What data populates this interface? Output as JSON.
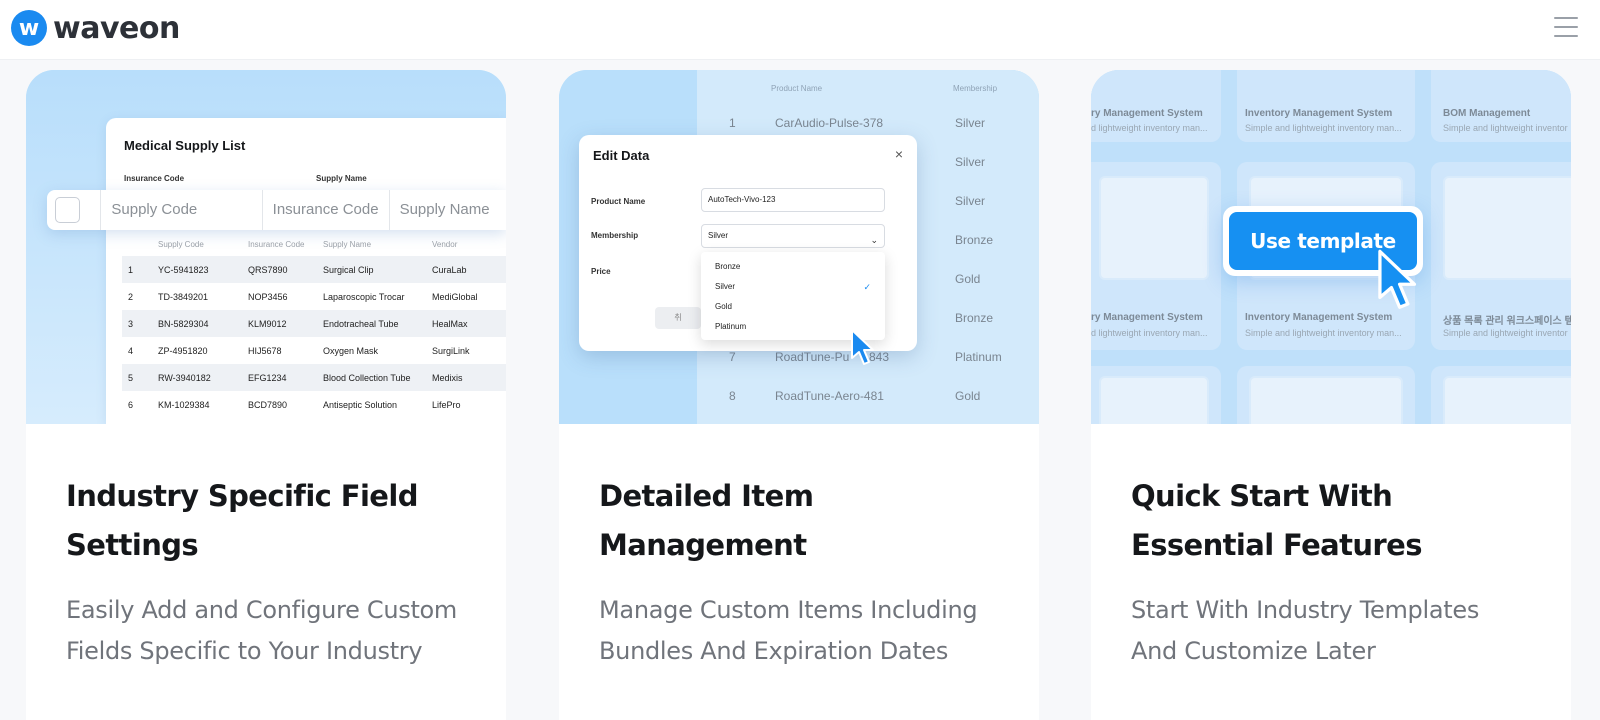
{
  "brand": {
    "name": "waveon",
    "mark": "w"
  },
  "colors": {
    "accent": "#1a8af0",
    "title": "#15171a",
    "description": "#70747b"
  },
  "header": {
    "menu_icon": "hamburger-menu-icon"
  },
  "cards": [
    {
      "title": "Industry Specific Field Settings",
      "description": "Easily Add and Configure Custom Fields Specific to Your Industry",
      "mock": {
        "panel_title": "Medical Supply List",
        "field_labels": [
          "Insurance Code",
          "Supply Name"
        ],
        "filter_columns": [
          "Supply Code",
          "Insurance Code",
          "Supply Name"
        ],
        "table_headers": [
          "Supply Code",
          "Insurance Code",
          "Supply Name",
          "Vendor"
        ],
        "rows": [
          [
            "1",
            "YC-5941823",
            "QRS7890",
            "Surgical Clip",
            "CuraLab"
          ],
          [
            "2",
            "TD-3849201",
            "NOP3456",
            "Laparoscopic Trocar",
            "MediGlobal"
          ],
          [
            "3",
            "BN-5829304",
            "KLM9012",
            "Endotracheal Tube",
            "HealMax"
          ],
          [
            "4",
            "ZP-4951820",
            "HIJ5678",
            "Oxygen Mask",
            "SurgiLink"
          ],
          [
            "5",
            "RW-3940182",
            "EFG1234",
            "Blood Collection Tube",
            "Medixis"
          ],
          [
            "6",
            "KM-1029384",
            "BCD7890",
            "Antiseptic Solution",
            "LifePro"
          ]
        ]
      }
    },
    {
      "title": "Detailed Item Management",
      "description": "Manage Custom Items Including Bundles And Expiration Dates",
      "mock": {
        "list_headers": [
          "Product Name",
          "Membership"
        ],
        "list_rows": [
          [
            "1",
            "CarAudio-Pulse-378",
            "Silver"
          ],
          [
            "2",
            "",
            "Silver"
          ],
          [
            "3",
            "",
            "Silver"
          ],
          [
            "4",
            "",
            "Bronze"
          ],
          [
            "5",
            "",
            "Gold"
          ],
          [
            "6",
            "",
            "Bronze"
          ],
          [
            "7",
            "RoadTune-Pu",
            "843",
            "Platinum"
          ],
          [
            "8",
            "RoadTune-Aero-481",
            "Gold"
          ]
        ],
        "modal_title": "Edit Data",
        "close_icon": "×",
        "product_name_label": "Product Name",
        "product_name_value": "AutoTech-Vivo-123",
        "membership_label": "Membership",
        "membership_value": "Silver",
        "price_label": "Price",
        "options": [
          "Bronze",
          "Silver",
          "Gold",
          "Platinum"
        ],
        "selected_option": "Silver",
        "check_mark": "✓",
        "cancel_fragment": "취"
      }
    },
    {
      "title": "Quick Start With Essential Features",
      "description": "Start With Industry Templates And Customize Later",
      "mock": {
        "use_template_label": "Use template",
        "tiles_row1": [
          {
            "title": "ry Management System",
            "subtitle": "d lightweight inventory man..."
          },
          {
            "title": "Inventory Management System",
            "subtitle": "Simple and lightweight inventory man..."
          },
          {
            "title": "BOM Management",
            "subtitle": "Simple and lightweight inventor"
          }
        ],
        "tiles_row2": [
          {
            "title": "ry Management System",
            "subtitle": "d lightweight inventory man..."
          },
          {
            "title": "Inventory Management System",
            "subtitle": "Simple and lightweight inventory man..."
          },
          {
            "title": "상품 목록 관리 워크스페이스 템",
            "subtitle": "Simple and lightweight inventor"
          }
        ]
      }
    }
  ]
}
